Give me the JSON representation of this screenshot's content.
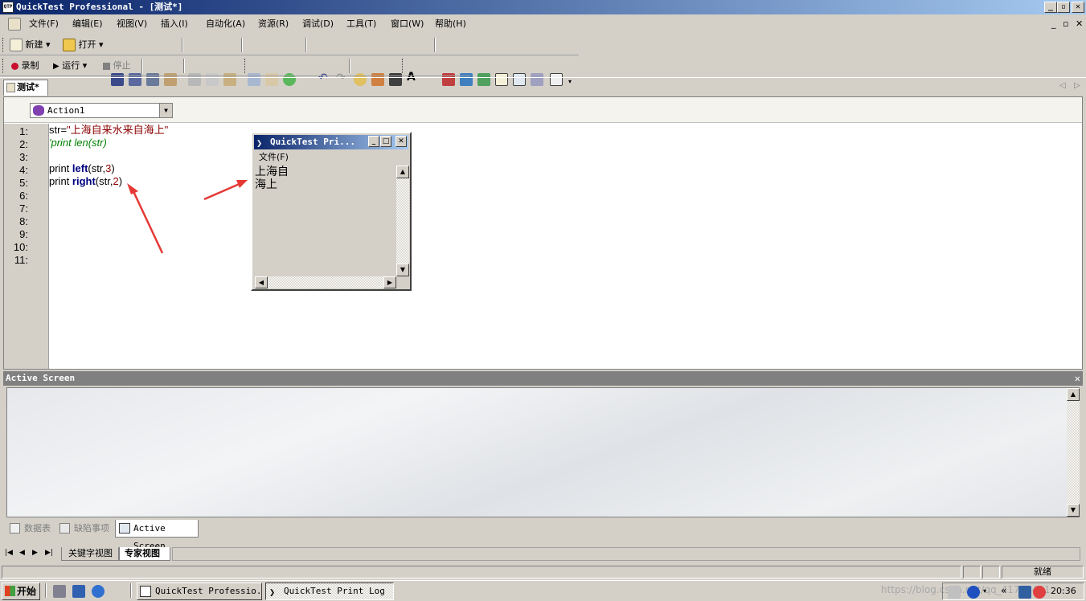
{
  "window": {
    "title": "QuickTest Professional - [测试*]",
    "app_icon": "QTP",
    "minimize_label": "_",
    "maximize_label": "▫",
    "close_label": "✕"
  },
  "menu": {
    "items": [
      "文件(F)",
      "编辑(E)",
      "视图(V)",
      "插入(I)",
      "自动化(A)",
      "资源(R)",
      "调试(D)",
      "工具(T)",
      "窗口(W)",
      "帮助(H)"
    ],
    "mdi_minimize": "_",
    "mdi_restore": "▫",
    "mdi_close": "✕"
  },
  "toolbar1": {
    "new_label": "新建",
    "open_label": "打开"
  },
  "toolbar2": {
    "record_label": "录制",
    "run_label": "运行",
    "stop_label": "停止"
  },
  "document": {
    "tab_label": "测试*",
    "action_select": "Action1"
  },
  "editor": {
    "line_numbers": [
      "1:",
      "2:",
      "3:",
      "4:",
      "5:",
      "6:",
      "7:",
      "8:",
      "9:",
      "10:",
      "11:"
    ],
    "line1_var": "str=",
    "line1_string": "\"上海自来水来自海上\"",
    "line2_comment": "'print len(str)",
    "line4_print": "print ",
    "line4_func": "left",
    "line4_args_open": "(str,",
    "line4_num": "3",
    "line4_close": ")",
    "line5_print": "print ",
    "line5_func": "right",
    "line5_args_open": "(str,",
    "line5_num": "2",
    "line5_close": ")"
  },
  "print_log": {
    "title": "QuickTest Pri...",
    "menu_file": "文件(F)",
    "output": "上海自\n海上"
  },
  "active_screen": {
    "title": "Active Screen",
    "close_label": "✕"
  },
  "bottom_tabs": [
    "数据表",
    "缺陷事项",
    "Active Screen"
  ],
  "view_tabs": [
    "关键字视图",
    "专家视图"
  ],
  "status": {
    "text": "就绪"
  },
  "taskbar": {
    "start_label": "开始",
    "buttons": [
      "QuickTest Professio...",
      "QuickTest Print Log"
    ],
    "clock": "20:36",
    "watermark": "https://blog.csdn.net/qq_41700421"
  },
  "colors": {
    "titlebar_start": "#0a246a",
    "titlebar_end": "#a6caf0",
    "string_color": "#8b0000",
    "comment_color": "#008000",
    "keyword_color": "#000080",
    "annotation_arrow": "#e53935"
  }
}
